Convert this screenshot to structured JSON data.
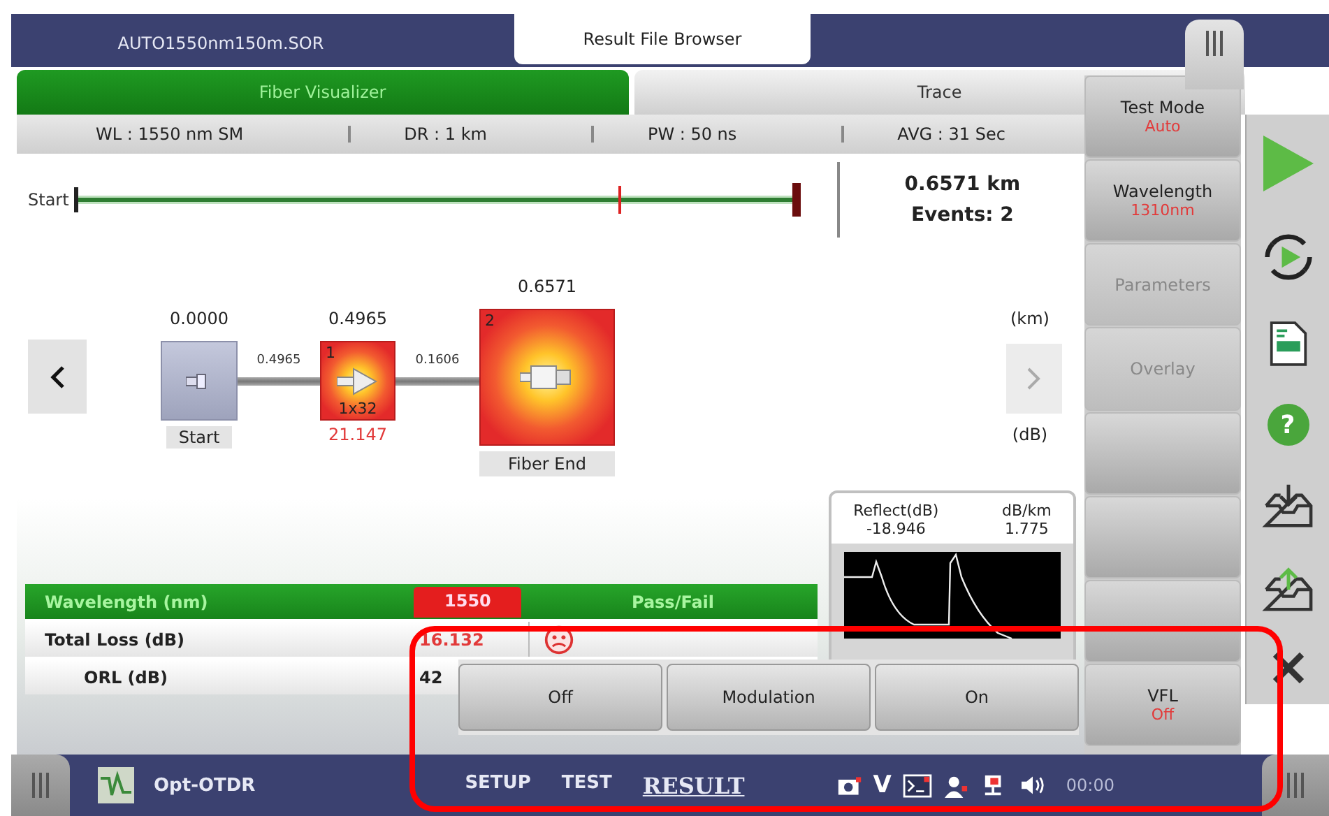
{
  "file_tabs": [
    {
      "label": "AUTO1550nm150m.SOR",
      "selected": false
    },
    {
      "label": "Result File Browser",
      "selected": true
    }
  ],
  "view_tabs": [
    {
      "label": "Fiber Visualizer",
      "selected": true
    },
    {
      "label": "Trace",
      "selected": false
    }
  ],
  "info_bar": [
    "WL : 1550 nm SM",
    "DR : 1 km",
    "PW : 50 ns",
    "AVG : 31 Sec"
  ],
  "overview": {
    "start_label": "Start",
    "distance": "0.6571 km",
    "events": "Events: 2"
  },
  "diagram": {
    "nodes": [
      {
        "kind": "start",
        "distance": "0.0000",
        "label": "Start"
      },
      {
        "kind": "splitter",
        "number": "1",
        "distance": "0.4965",
        "ratio": "1x32",
        "loss": "21.147",
        "fail": true
      },
      {
        "kind": "end",
        "number": "2",
        "distance": "0.6571",
        "label": "Fiber End",
        "fail": true
      }
    ],
    "spans": [
      "0.4965",
      "0.1606"
    ],
    "unit_distance": "(km)",
    "unit_loss": "(dB)",
    "prev_disabled": false,
    "next_disabled": true
  },
  "event_detail": [
    {
      "label": "Reflect(dB)",
      "value": "-18.946"
    },
    {
      "label": "dB/km",
      "value": "1.775"
    }
  ],
  "results": {
    "heading": "Wavelength (nm)",
    "wavelength": "1550",
    "status_heading": "Pass/Fail",
    "rows": [
      {
        "label": "Total Loss (dB)",
        "value": "16.132",
        "fail": true
      },
      {
        "label": "ORL (dB)",
        "value": "42",
        "fail": false
      }
    ]
  },
  "side_buttons": [
    {
      "kind": "button",
      "label": "Test Mode",
      "value": "Auto",
      "disabled": false
    },
    {
      "kind": "button",
      "label": "Wavelength",
      "value": "1310nm",
      "disabled": false
    },
    {
      "kind": "button",
      "label": "Parameters",
      "disabled": true
    },
    {
      "kind": "button",
      "label": "Overlay",
      "disabled": true
    },
    {
      "kind": "blank"
    },
    {
      "kind": "blank"
    },
    {
      "kind": "blank"
    },
    {
      "kind": "button",
      "label": "VFL",
      "value": "Off",
      "disabled": false
    }
  ],
  "vfl_menu": [
    "Off",
    "Modulation",
    "On"
  ],
  "toolbar": {
    "help_glyph": "?"
  },
  "bottom_bar": {
    "app_name": "Opt-OTDR",
    "nav": [
      {
        "label": "SETUP",
        "selected": false
      },
      {
        "label": "TEST",
        "selected": false
      },
      {
        "label": "RESULT",
        "selected": true
      }
    ],
    "status_letter": "V",
    "clock": "00:00"
  }
}
